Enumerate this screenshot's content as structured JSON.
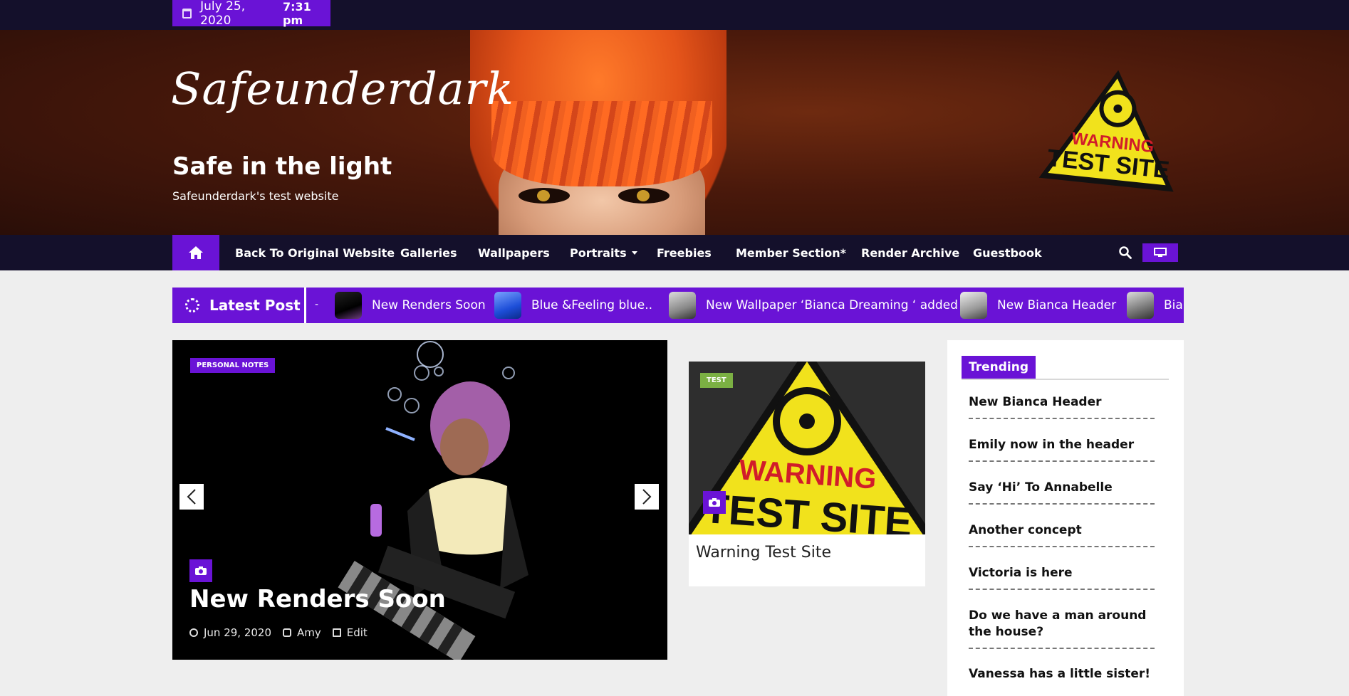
{
  "topbar": {
    "date": "July 25, 2020",
    "time": "7:31 pm"
  },
  "header": {
    "script_title": "Safeunderdark",
    "title": "Safe in the light",
    "description": "Safeunderdark's test website",
    "logo_text_1": "WARNING",
    "logo_text_2": "TEST SITE"
  },
  "nav": {
    "items": [
      {
        "label": "Back To Original Website"
      },
      {
        "label": "Galleries"
      },
      {
        "label": "Wallpapers"
      },
      {
        "label": "Portraits"
      },
      {
        "label": "Freebies"
      },
      {
        "label": "Member Section*"
      },
      {
        "label": "Render Archive"
      },
      {
        "label": "Guestbook"
      }
    ]
  },
  "ticker": {
    "label": "Latest Post",
    "lead": "-",
    "items": [
      {
        "title": "New Renders Soon"
      },
      {
        "title": "Blue &Feeling blue.."
      },
      {
        "title": "New Wallpaper ‘Bianca Dreaming ‘ added"
      },
      {
        "title": "New Bianca Header"
      },
      {
        "title": "Bian"
      }
    ]
  },
  "featured": {
    "category": "PERSONAL NOTES",
    "title": "New Renders Soon",
    "date": "Jun 29, 2020",
    "author": "Amy",
    "edit": "Edit"
  },
  "card": {
    "category": "TEST",
    "title": "Warning Test Site",
    "image_text_1": "WARNING",
    "image_text_2": "TEST SITE"
  },
  "trending": {
    "heading": "Trending",
    "items": [
      "New Bianca Header",
      "Emily now in the header",
      "Say ‘Hi’ To Annabelle",
      "Another concept",
      "Victoria is here",
      "Do we have a man around the house?",
      "Vanessa has a little sister!"
    ]
  },
  "colors": {
    "accent": "#6a13d6",
    "dark": "#14102b",
    "page_bg": "#eeeeee",
    "test_badge": "#7bb043"
  }
}
